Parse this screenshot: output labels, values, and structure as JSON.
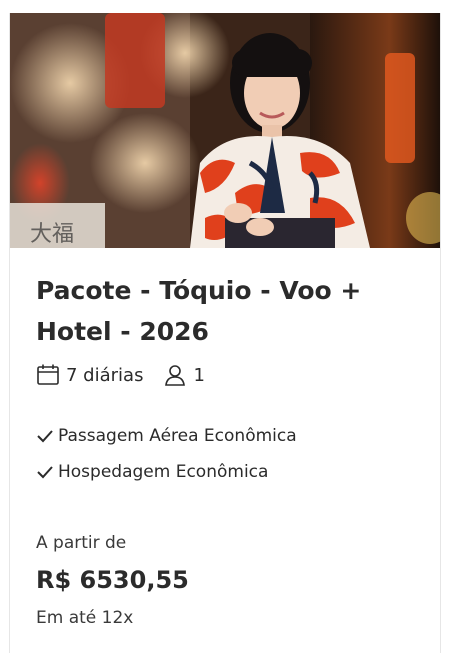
{
  "package": {
    "title": "Pacote - Tóquio - Voo + Hotel - 2026",
    "nights_icon": "calendar-icon",
    "nights": "7 diárias",
    "travelers_icon": "person-icon",
    "travelers": "1"
  },
  "features": [
    {
      "icon": "check-icon",
      "label": "Passagem Aérea Econômica"
    },
    {
      "icon": "check-icon",
      "label": "Hospedagem Econômica"
    }
  ],
  "pricing": {
    "from_label": "A partir de",
    "price": "R$ 6530,55",
    "installments": "Em até 12x"
  },
  "colors": {
    "text": "#2b2b2b",
    "kimono_red": "#e0401c",
    "border": "#e6e6e6"
  }
}
